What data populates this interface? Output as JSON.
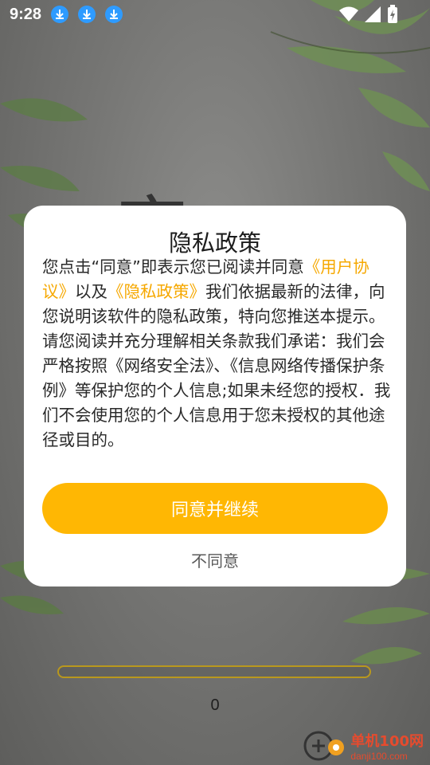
{
  "status_bar": {
    "time": "9:28",
    "notification_icons": [
      "download-icon",
      "download-icon",
      "download-icon"
    ],
    "right_icons": [
      "wifi-icon",
      "signal-icon",
      "battery-charging-icon"
    ]
  },
  "background": {
    "title_partial": "穿"
  },
  "dialog": {
    "title": "隐私政策",
    "body_1": "您点击“同意”即表示您已阅读并同意",
    "link_user_agreement": "《用户协议》",
    "body_2": "以及",
    "link_privacy_policy": "《隐私政策》",
    "body_3": "我们依据最新的法律，向您说明该软件的隐私政策，特向您推送本提示。请您阅读并充分理解相关条款我们承诺：我们会严格按照《网络安全法》、《信息网络传播保护条例》等保护您的个人信息;如果未经您的授权．我们不会使用您的个人信息用于您未授权的其他途径或目的。",
    "agree_label": "同意并继续",
    "disagree_label": "不同意"
  },
  "loading": {
    "progress_value": 0,
    "progress_text": "0"
  },
  "watermark": {
    "name": "单机100网",
    "url": "danji100.com"
  },
  "colors": {
    "accent": "#ffb703",
    "link": "#f6a800",
    "dialog_bg": "#ffffff"
  }
}
